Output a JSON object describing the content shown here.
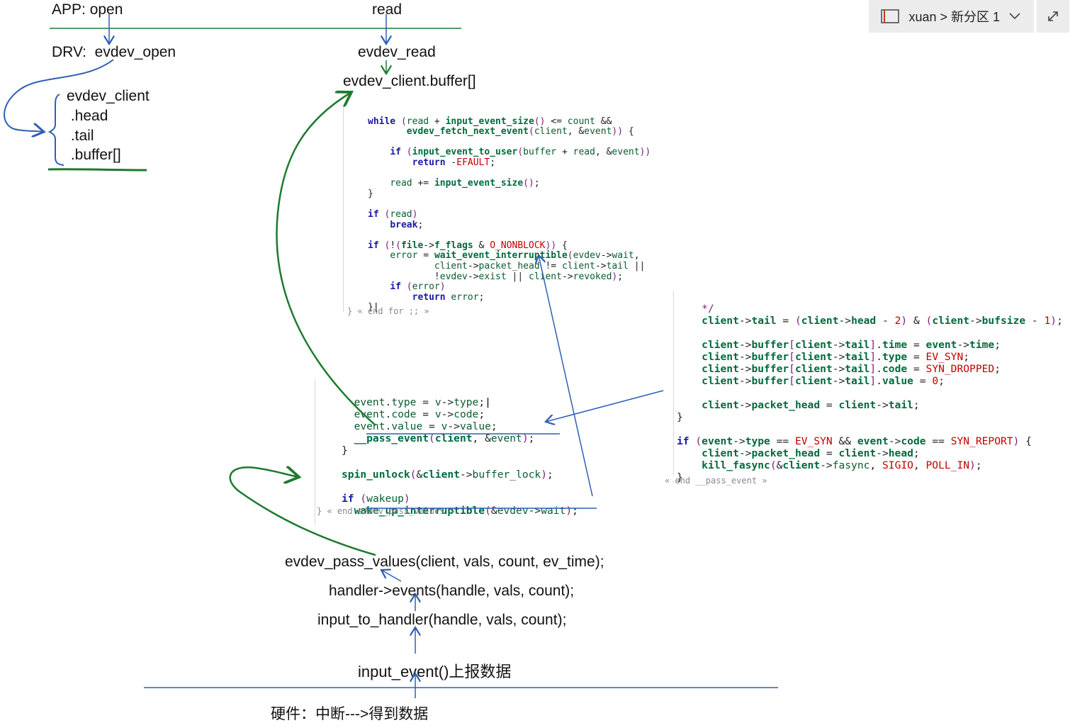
{
  "header": {
    "notebook_path": "xuan > 新分区 1",
    "notebook_icon": "notebook-icon",
    "chevron_icon": "chevron-down-icon",
    "expand_icon": "expand-icon"
  },
  "labels": {
    "app_open": "APP: open",
    "read": "read",
    "drv_open": "DRV:  evdev_open",
    "evdev_read": "evdev_read",
    "client_buffer": "evdev_client.buffer[]",
    "struct_name": "evdev_client",
    "field_head": " .head",
    "field_tail": " .tail",
    "field_buffer": " .buffer[]",
    "pass_values": "evdev_pass_values(client, vals, count, ev_time);",
    "handler_events": "handler->events(handle, vals, count);",
    "input_to_handler": "input_to_handler(handle, vals, count);",
    "input_event": "input_event()上报数据",
    "hardware": "硬件：中断--->得到数据"
  },
  "code_read": [
    "while (read + input_event_size() <= count &&",
    "       evdev_fetch_next_event(client, &event)) {",
    "",
    "    if (input_event_to_user(buffer + read, &event))",
    "        return -EFAULT;",
    "",
    "    read += input_event_size();",
    "}",
    "",
    "if (read)",
    "    break;",
    "",
    "if (!(file->f_flags & O_NONBLOCK)) {",
    "    error = wait_event_interruptible(evdev->wait,",
    "            client->packet_head != client->tail ||",
    "            !evdev->exist || client->revoked);",
    "    if (error)",
    "        return error;",
    "}"
  ],
  "fold_read": "} « end for ;; »",
  "code_pass_event": [
    "    */",
    "    client->tail = (client->head - 2) & (client->bufsize - 1);",
    "",
    "    client->buffer[client->tail].time = event->time;",
    "    client->buffer[client->tail].type = EV_SYN;",
    "    client->buffer[client->tail].code = SYN_DROPPED;",
    "    client->buffer[client->tail].value = 0;",
    "",
    "    client->packet_head = client->tail;",
    "}",
    "",
    "if (event->type == EV_SYN && event->code == SYN_REPORT) {",
    "    client->packet_head = client->head;",
    "    kill_fasync(&client->fasync, SIGIO, POLL_IN);",
    "}"
  ],
  "fold_pass_event": "« end __pass_event »",
  "code_pass_values": [
    "    event.type = v->type;",
    "    event.code = v->code;",
    "    event.value = v->value;",
    "    __pass_event(client, &event);",
    "}",
    "",
    "spin_unlock(&client->buffer_lock);",
    "",
    "if (wakeup)",
    "    wake_up_interruptible(&evdev->wait);"
  ],
  "fold_pass_values": "} « end evdev_pass_values »",
  "colors": {
    "ink_blue": "#2f5fb3",
    "ink_green": "#1e7a2e",
    "keyword": "#1a1aa6",
    "function": "#006b3c",
    "macro": "#c00000"
  }
}
